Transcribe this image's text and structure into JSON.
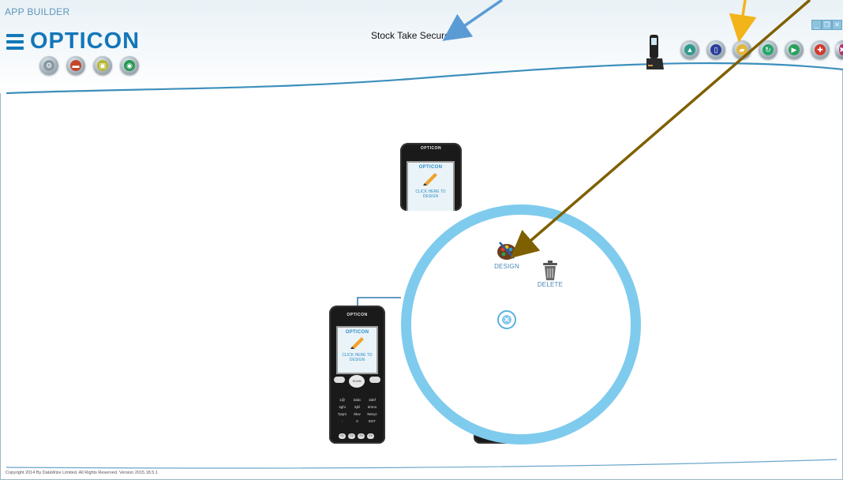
{
  "window": {
    "title": "APP BUILDER"
  },
  "brand": {
    "logo_text": "OPTICON"
  },
  "header": {
    "heading": "Stock Take Secured"
  },
  "left_toolbar": [
    {
      "name": "settings-icon",
      "glyph": "⚙",
      "color": "#8a9aa3"
    },
    {
      "name": "card-icon",
      "glyph": "▬",
      "color": "#c3462b"
    },
    {
      "name": "image-icon",
      "glyph": "▣",
      "color": "#b9b531"
    },
    {
      "name": "globe-icon",
      "glyph": "◉",
      "color": "#2a9a55"
    }
  ],
  "right_toolbar": [
    {
      "name": "upload-icon",
      "glyph": "▲",
      "color": "#2f9b8a"
    },
    {
      "name": "device-icon",
      "glyph": "▯",
      "color": "#2c3e9a"
    },
    {
      "name": "folder-icon",
      "glyph": "▰",
      "color": "#e1b73b"
    },
    {
      "name": "refresh-icon",
      "glyph": "↻",
      "color": "#27a56a"
    },
    {
      "name": "play-icon",
      "glyph": "▶",
      "color": "#2aa05c"
    },
    {
      "name": "lifebuoy-icon",
      "glyph": "✚",
      "color": "#d23a2e"
    },
    {
      "name": "flag-icon",
      "glyph": "✖",
      "color": "#b2336a"
    }
  ],
  "window_controls": {
    "minimize": "_",
    "restore": "❐",
    "close": "✕"
  },
  "device_cards": [
    {
      "brand": "OPTICON",
      "screen_brand": "OPTICON",
      "screen_text": "CLICK HERE TO DESIGN"
    },
    {
      "brand": "OPTICON",
      "screen_brand": "OPTICON",
      "screen_text": "CLICK HERE TO DESIGN"
    }
  ],
  "keypad": {
    "nav_center": "SCAN",
    "keys": [
      "1@",
      "2abc",
      "3def",
      "4ghi",
      "5jkl",
      "6mno",
      "7pqrs",
      "8tuv",
      "9wxyz",
      "-",
      "0",
      "ENT"
    ],
    "fkeys": [
      "F1",
      "F2",
      "F3",
      "F4"
    ]
  },
  "menu_actions": {
    "design_label": "DESIGN",
    "delete_label": "DELETE",
    "close_glyph": "✕"
  },
  "annotations": [
    {
      "color": "#5b9bd5"
    },
    {
      "color": "#f3b41a"
    },
    {
      "color": "#7f6000"
    }
  ],
  "footer": {
    "copyright": "Copyright 2014 By DataWize Limited. All Rights Reserved. Version 2015.18.5.1"
  }
}
